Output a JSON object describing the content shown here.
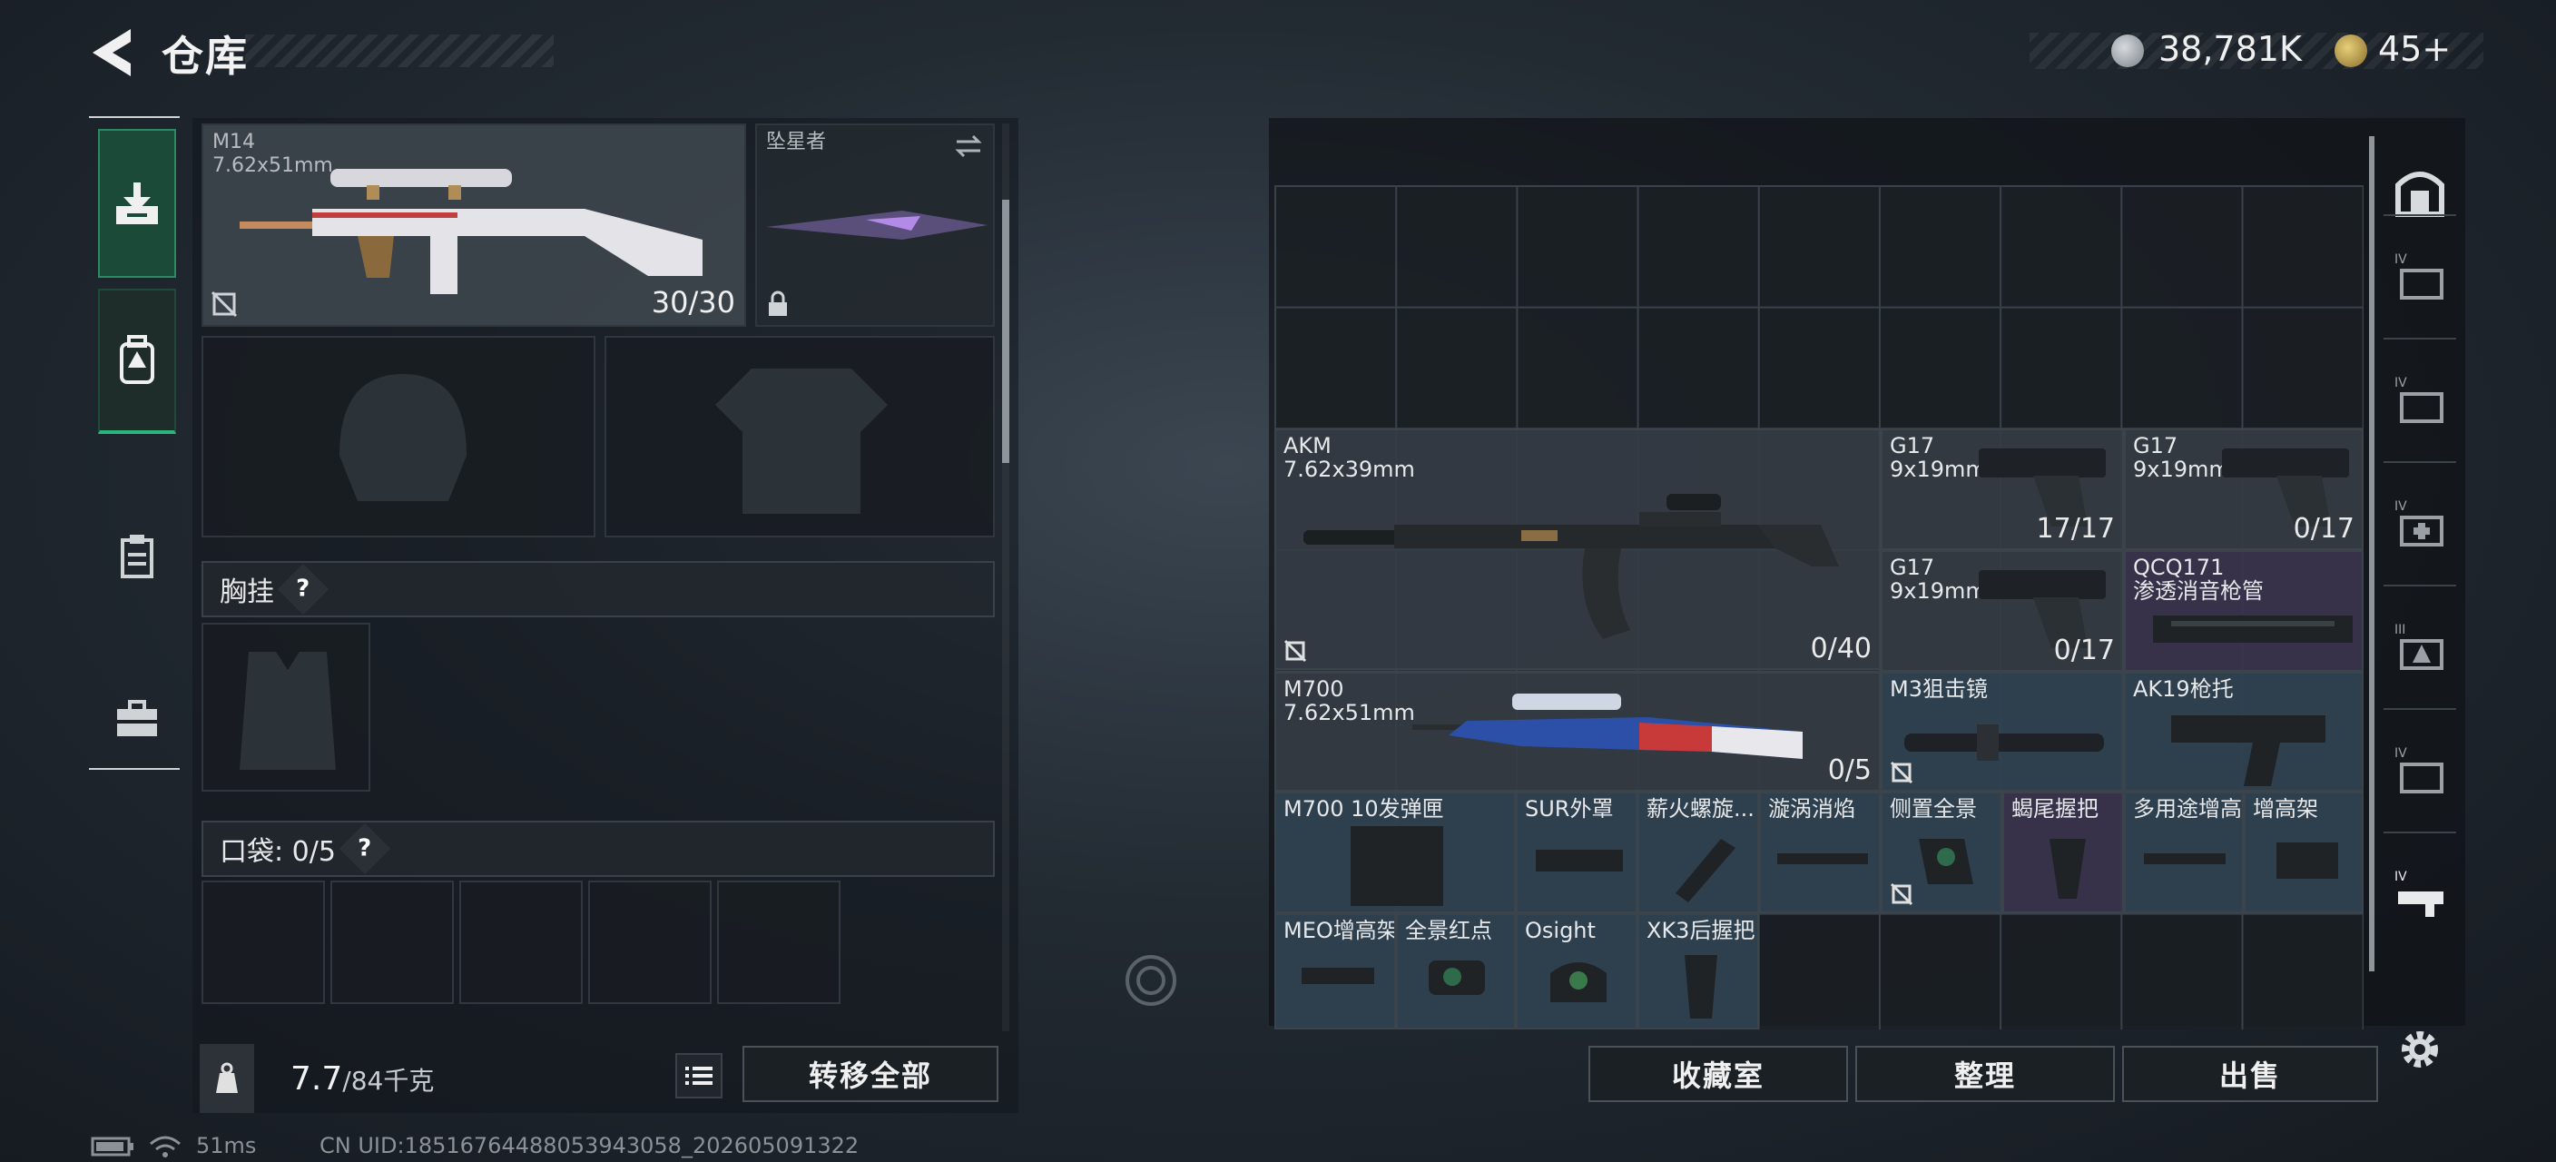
{
  "header": {
    "title": "仓库",
    "currency_silver": "38,781K",
    "currency_gold": "45+"
  },
  "left": {
    "primary_weapon": {
      "name": "M14",
      "caliber": "7.62x51mm",
      "ammo": "30/30"
    },
    "melee": {
      "name": "坠星者"
    },
    "chest_rig_label": "胸挂",
    "pockets_label": "口袋: 0/5",
    "weight_value": "7.7",
    "weight_limit": "/84千克",
    "transfer_all": "转移全部"
  },
  "grid_items": [
    {
      "name": "AKM",
      "sub": "7.62x39mm",
      "count": "0/40"
    },
    {
      "name": "G17",
      "sub": "9x19mm",
      "count": "17/17"
    },
    {
      "name": "G17",
      "sub": "9x19mm",
      "count": "0/17"
    },
    {
      "name": "G17",
      "sub": "9x19mm",
      "count": "0/17"
    },
    {
      "name": "QCQ171",
      "sub": "渗透消音枪管",
      "count": ""
    },
    {
      "name": "M700",
      "sub": "7.62x51mm",
      "count": "0/5"
    },
    {
      "name": "M3狙击镜",
      "sub": "",
      "count": ""
    },
    {
      "name": "AK19枪托",
      "sub": "",
      "count": ""
    },
    {
      "name": "M700 10发弹匣",
      "sub": "",
      "count": ""
    },
    {
      "name": "SUR外罩",
      "sub": "",
      "count": ""
    },
    {
      "name": "薪火螺旋...",
      "sub": "",
      "count": ""
    },
    {
      "name": "漩涡消焰",
      "sub": "",
      "count": ""
    },
    {
      "name": "侧置全景",
      "sub": "",
      "count": ""
    },
    {
      "name": "蝎尾握把",
      "sub": "",
      "count": ""
    },
    {
      "name": "多用途增高",
      "sub": "",
      "count": ""
    },
    {
      "name": "增高架",
      "sub": "",
      "count": ""
    },
    {
      "name": "MEO增高架",
      "sub": "",
      "count": ""
    },
    {
      "name": "全景红点",
      "sub": "",
      "count": ""
    },
    {
      "name": "Osight",
      "sub": "",
      "count": ""
    },
    {
      "name": "XK3后握把",
      "sub": "",
      "count": ""
    }
  ],
  "right_buttons": {
    "collection": "收藏室",
    "organize": "整理",
    "sell": "出售"
  },
  "status": {
    "ping": "51ms",
    "uid": "CN UID:18516764488053943058_202605091322"
  },
  "colors": {
    "accent_green": "#1f8a5c",
    "item_blue": "#304252",
    "item_purple": "#3a344e"
  }
}
